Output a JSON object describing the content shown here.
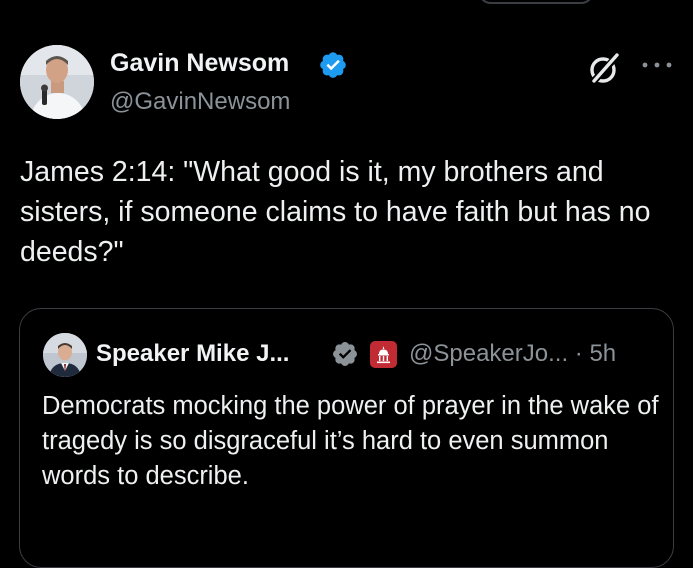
{
  "post": {
    "author": {
      "name": "Gavin Newsom",
      "handle": "@GavinNewsom",
      "verified": true,
      "avatar": "gavin-newsom-avatar"
    },
    "text": "James 2:14: \"What good is it, my brothers and sisters, if someone claims to have faith but has no deeds?\"",
    "icons": {
      "grok": "grok-icon",
      "more": "more-options-icon"
    }
  },
  "quoted_post": {
    "author": {
      "name": "Speaker Mike J...",
      "handle": "@SpeakerJo...",
      "verified": true,
      "affiliation_badge": "government-badge-icon",
      "avatar": "speaker-avatar"
    },
    "separator": "·",
    "time": "5h",
    "text": "Democrats mocking the power of prayer in the wake of tragedy is so disgraceful it’s hard to even summon words to describe."
  },
  "colors": {
    "background": "#000000",
    "text_primary": "#e7e9ea",
    "text_secondary": "#8b9298",
    "verified_blue": "#1d9bf0",
    "border": "#3a3e43",
    "gov_badge": "#c12b33"
  }
}
